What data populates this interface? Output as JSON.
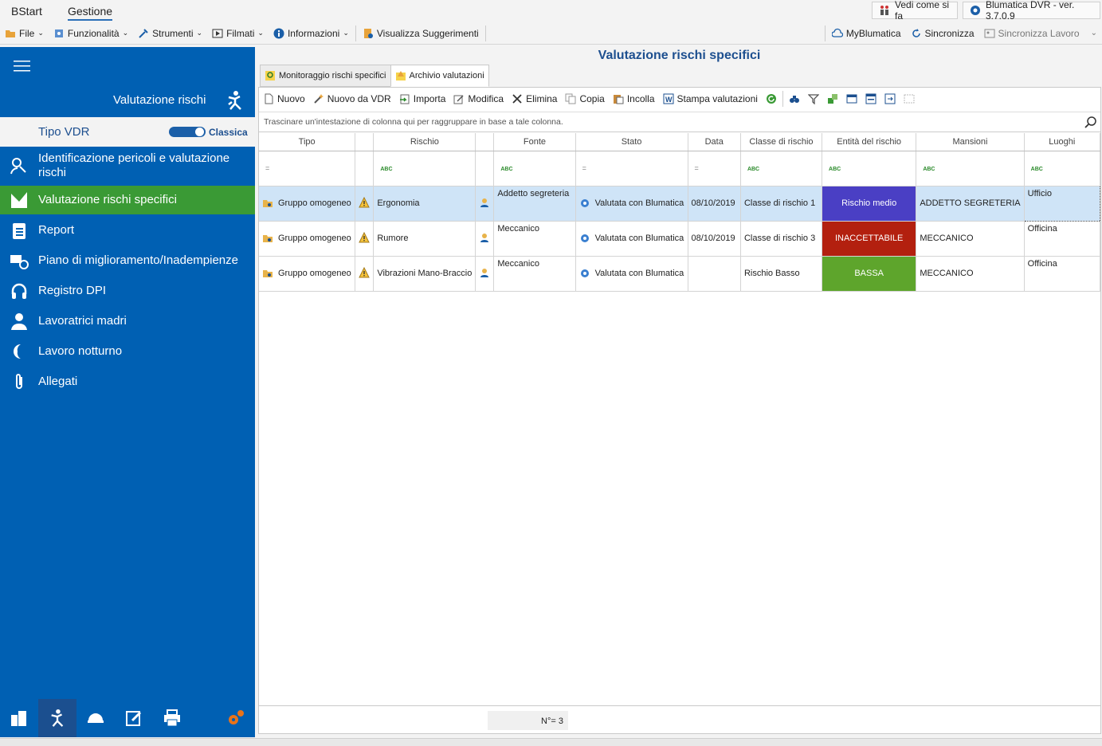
{
  "ribbon": {
    "tabs": [
      "BStart",
      "Gestione"
    ],
    "vedi_come": "Vedi come si fa",
    "version": "Blumatica DVR - ver. 3.7.0.9"
  },
  "toolbar": {
    "file": "File",
    "funzionalita": "Funzionalità",
    "strumenti": "Strumenti",
    "filmati": "Filmati",
    "informazioni": "Informazioni",
    "suggerimenti": "Visualizza Suggerimenti",
    "myblumatica": "MyBlumatica",
    "sincronizza": "Sincronizza",
    "sincronizza_lavoro": "Sincronizza Lavoro"
  },
  "sidebar": {
    "title": "Valutazione rischi",
    "tipo_label": "Tipo VDR",
    "tipo_value": "Classica",
    "items": [
      {
        "label": "Identificazione pericoli e valutazione rischi",
        "icon": "search-person-icon"
      },
      {
        "label": "Valutazione rischi specifici",
        "icon": "chart-icon"
      },
      {
        "label": "Report",
        "icon": "clipboard-icon"
      },
      {
        "label": "Piano di miglioramento/Inadempienze",
        "icon": "truck-refresh-icon"
      },
      {
        "label": "Registro DPI",
        "icon": "headphones-icon"
      },
      {
        "label": "Lavoratrici madri",
        "icon": "mother-icon"
      },
      {
        "label": "Lavoro notturno",
        "icon": "moon-icon"
      },
      {
        "label": "Allegati",
        "icon": "paperclip-icon"
      }
    ]
  },
  "main": {
    "title": "Valutazione rischi specifici",
    "tabs": [
      "Monitoraggio rischi specifici",
      "Archivio valutazioni"
    ],
    "actions": {
      "nuovo": "Nuovo",
      "nuovo_vdr": "Nuovo da VDR",
      "importa": "Importa",
      "modifica": "Modifica",
      "elimina": "Elimina",
      "copia": "Copia",
      "incolla": "Incolla",
      "stampa": "Stampa valutazioni"
    },
    "group_hint": "Trascinare un'intestazione di colonna qui per raggruppare in base a tale colonna.",
    "columns": [
      "Tipo",
      "",
      "Rischio",
      "",
      "Fonte",
      "Stato",
      "Data",
      "Classe di rischio",
      "Entità del rischio",
      "Mansioni",
      "Luoghi"
    ],
    "filter_ops": [
      "=",
      "",
      "ABC",
      "",
      "ABC",
      "=",
      "=",
      "ABC",
      "ABC",
      "ABC",
      "ABC"
    ],
    "rows": [
      {
        "tipo": "Gruppo omogeneo",
        "rischio": "Ergonomia",
        "fonte": "Addetto segreteria",
        "stato": "Valutata con Blumatica",
        "data": "08/10/2019",
        "classe": "Classe di rischio 1",
        "entita": "Rischio medio",
        "entita_color": "#4a3fc4",
        "mansioni": "ADDETTO SEGRETERIA",
        "luoghi": "Ufficio"
      },
      {
        "tipo": "Gruppo omogeneo",
        "rischio": "Rumore",
        "fonte": "Meccanico",
        "stato": "Valutata con Blumatica",
        "data": "08/10/2019",
        "classe": "Classe di rischio 3",
        "entita": "INACCETTABILE",
        "entita_color": "#b3200f",
        "mansioni": "MECCANICO",
        "luoghi": "Officina"
      },
      {
        "tipo": "Gruppo omogeneo",
        "rischio": "Vibrazioni Mano-Braccio",
        "fonte": "Meccanico",
        "stato": "Valutata con Blumatica",
        "data": "",
        "classe": "Rischio Basso",
        "entita": "BASSA",
        "entita_color": "#5ea52c",
        "mansioni": "MECCANICO",
        "luoghi": "Officina"
      }
    ],
    "count": "N°= 3"
  },
  "colors": {
    "sidebar_bg": "#0060b3",
    "active_item": "#3a9a35",
    "selected_row": "#cfe4f7"
  }
}
